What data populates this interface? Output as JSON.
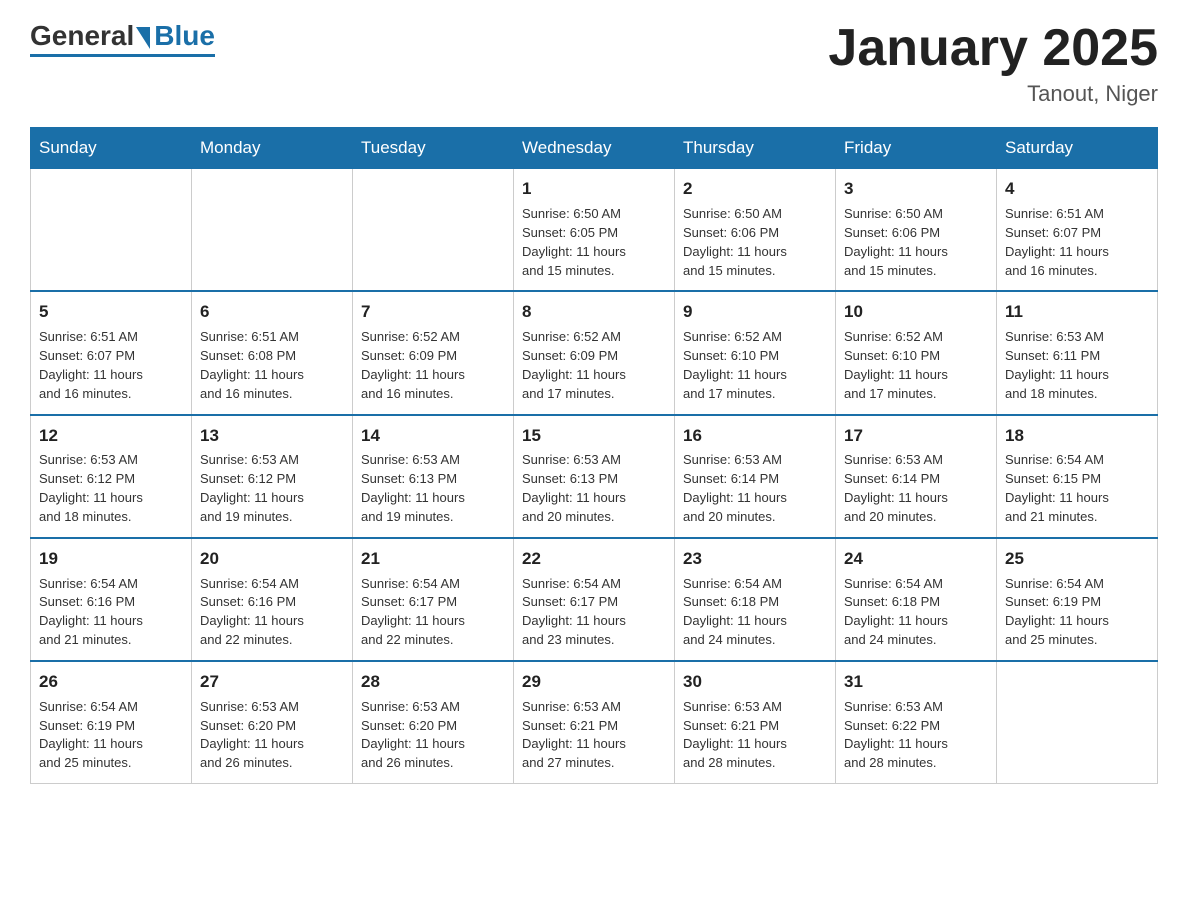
{
  "logo": {
    "general": "General",
    "blue": "Blue"
  },
  "header": {
    "month": "January 2025",
    "location": "Tanout, Niger"
  },
  "days_header": [
    "Sunday",
    "Monday",
    "Tuesday",
    "Wednesday",
    "Thursday",
    "Friday",
    "Saturday"
  ],
  "weeks": [
    [
      {
        "day": "",
        "info": ""
      },
      {
        "day": "",
        "info": ""
      },
      {
        "day": "",
        "info": ""
      },
      {
        "day": "1",
        "info": "Sunrise: 6:50 AM\nSunset: 6:05 PM\nDaylight: 11 hours\nand 15 minutes."
      },
      {
        "day": "2",
        "info": "Sunrise: 6:50 AM\nSunset: 6:06 PM\nDaylight: 11 hours\nand 15 minutes."
      },
      {
        "day": "3",
        "info": "Sunrise: 6:50 AM\nSunset: 6:06 PM\nDaylight: 11 hours\nand 15 minutes."
      },
      {
        "day": "4",
        "info": "Sunrise: 6:51 AM\nSunset: 6:07 PM\nDaylight: 11 hours\nand 16 minutes."
      }
    ],
    [
      {
        "day": "5",
        "info": "Sunrise: 6:51 AM\nSunset: 6:07 PM\nDaylight: 11 hours\nand 16 minutes."
      },
      {
        "day": "6",
        "info": "Sunrise: 6:51 AM\nSunset: 6:08 PM\nDaylight: 11 hours\nand 16 minutes."
      },
      {
        "day": "7",
        "info": "Sunrise: 6:52 AM\nSunset: 6:09 PM\nDaylight: 11 hours\nand 16 minutes."
      },
      {
        "day": "8",
        "info": "Sunrise: 6:52 AM\nSunset: 6:09 PM\nDaylight: 11 hours\nand 17 minutes."
      },
      {
        "day": "9",
        "info": "Sunrise: 6:52 AM\nSunset: 6:10 PM\nDaylight: 11 hours\nand 17 minutes."
      },
      {
        "day": "10",
        "info": "Sunrise: 6:52 AM\nSunset: 6:10 PM\nDaylight: 11 hours\nand 17 minutes."
      },
      {
        "day": "11",
        "info": "Sunrise: 6:53 AM\nSunset: 6:11 PM\nDaylight: 11 hours\nand 18 minutes."
      }
    ],
    [
      {
        "day": "12",
        "info": "Sunrise: 6:53 AM\nSunset: 6:12 PM\nDaylight: 11 hours\nand 18 minutes."
      },
      {
        "day": "13",
        "info": "Sunrise: 6:53 AM\nSunset: 6:12 PM\nDaylight: 11 hours\nand 19 minutes."
      },
      {
        "day": "14",
        "info": "Sunrise: 6:53 AM\nSunset: 6:13 PM\nDaylight: 11 hours\nand 19 minutes."
      },
      {
        "day": "15",
        "info": "Sunrise: 6:53 AM\nSunset: 6:13 PM\nDaylight: 11 hours\nand 20 minutes."
      },
      {
        "day": "16",
        "info": "Sunrise: 6:53 AM\nSunset: 6:14 PM\nDaylight: 11 hours\nand 20 minutes."
      },
      {
        "day": "17",
        "info": "Sunrise: 6:53 AM\nSunset: 6:14 PM\nDaylight: 11 hours\nand 20 minutes."
      },
      {
        "day": "18",
        "info": "Sunrise: 6:54 AM\nSunset: 6:15 PM\nDaylight: 11 hours\nand 21 minutes."
      }
    ],
    [
      {
        "day": "19",
        "info": "Sunrise: 6:54 AM\nSunset: 6:16 PM\nDaylight: 11 hours\nand 21 minutes."
      },
      {
        "day": "20",
        "info": "Sunrise: 6:54 AM\nSunset: 6:16 PM\nDaylight: 11 hours\nand 22 minutes."
      },
      {
        "day": "21",
        "info": "Sunrise: 6:54 AM\nSunset: 6:17 PM\nDaylight: 11 hours\nand 22 minutes."
      },
      {
        "day": "22",
        "info": "Sunrise: 6:54 AM\nSunset: 6:17 PM\nDaylight: 11 hours\nand 23 minutes."
      },
      {
        "day": "23",
        "info": "Sunrise: 6:54 AM\nSunset: 6:18 PM\nDaylight: 11 hours\nand 24 minutes."
      },
      {
        "day": "24",
        "info": "Sunrise: 6:54 AM\nSunset: 6:18 PM\nDaylight: 11 hours\nand 24 minutes."
      },
      {
        "day": "25",
        "info": "Sunrise: 6:54 AM\nSunset: 6:19 PM\nDaylight: 11 hours\nand 25 minutes."
      }
    ],
    [
      {
        "day": "26",
        "info": "Sunrise: 6:54 AM\nSunset: 6:19 PM\nDaylight: 11 hours\nand 25 minutes."
      },
      {
        "day": "27",
        "info": "Sunrise: 6:53 AM\nSunset: 6:20 PM\nDaylight: 11 hours\nand 26 minutes."
      },
      {
        "day": "28",
        "info": "Sunrise: 6:53 AM\nSunset: 6:20 PM\nDaylight: 11 hours\nand 26 minutes."
      },
      {
        "day": "29",
        "info": "Sunrise: 6:53 AM\nSunset: 6:21 PM\nDaylight: 11 hours\nand 27 minutes."
      },
      {
        "day": "30",
        "info": "Sunrise: 6:53 AM\nSunset: 6:21 PM\nDaylight: 11 hours\nand 28 minutes."
      },
      {
        "day": "31",
        "info": "Sunrise: 6:53 AM\nSunset: 6:22 PM\nDaylight: 11 hours\nand 28 minutes."
      },
      {
        "day": "",
        "info": ""
      }
    ]
  ]
}
